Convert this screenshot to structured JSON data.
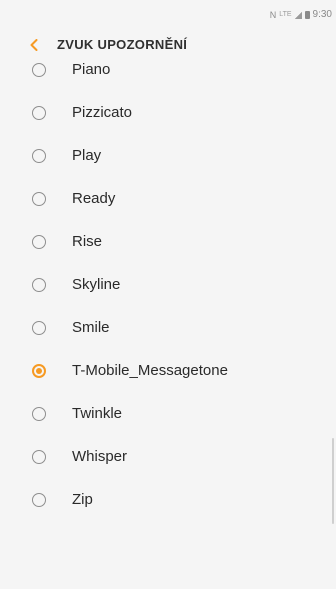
{
  "status_bar": {
    "network_label": "LTE",
    "time": "9:30"
  },
  "header": {
    "title": "ZVUK UPOZORNĚNÍ",
    "back_icon": "chevron-left-icon"
  },
  "colors": {
    "accent": "#f69a23",
    "background": "#f5f5f5",
    "text": "#2a2a2a"
  },
  "options": [
    {
      "label": "Piano",
      "selected": false
    },
    {
      "label": "Pizzicato",
      "selected": false
    },
    {
      "label": "Play",
      "selected": false
    },
    {
      "label": "Ready",
      "selected": false
    },
    {
      "label": "Rise",
      "selected": false
    },
    {
      "label": "Skyline",
      "selected": false
    },
    {
      "label": "Smile",
      "selected": false
    },
    {
      "label": "T-Mobile_Messagetone",
      "selected": true
    },
    {
      "label": "Twinkle",
      "selected": false
    },
    {
      "label": "Whisper",
      "selected": false
    },
    {
      "label": "Zip",
      "selected": false
    }
  ]
}
